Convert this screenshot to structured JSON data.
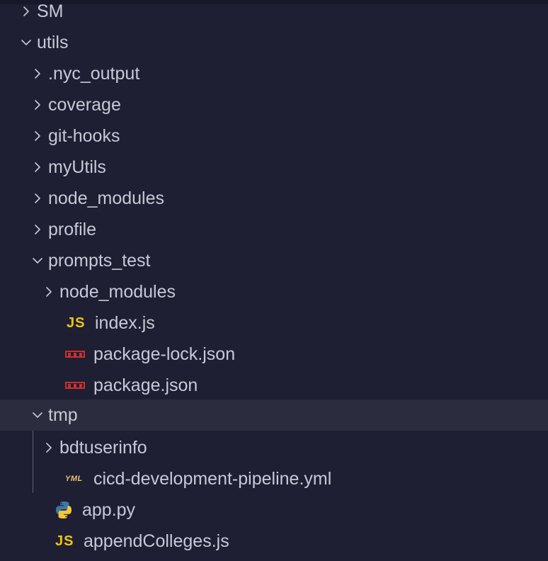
{
  "tree": {
    "items": [
      {
        "label": "SM",
        "kind": "folder",
        "expanded": false,
        "icon": "chevron-right-icon"
      },
      {
        "label": "utils",
        "kind": "folder",
        "expanded": true,
        "icon": "chevron-down-icon"
      },
      {
        "label": ".nyc_output",
        "kind": "folder",
        "expanded": false,
        "icon": "chevron-right-icon"
      },
      {
        "label": "coverage",
        "kind": "folder",
        "expanded": false,
        "icon": "chevron-right-icon"
      },
      {
        "label": "git-hooks",
        "kind": "folder",
        "expanded": false,
        "icon": "chevron-right-icon"
      },
      {
        "label": "myUtils",
        "kind": "folder",
        "expanded": false,
        "icon": "chevron-right-icon"
      },
      {
        "label": "node_modules",
        "kind": "folder",
        "expanded": false,
        "icon": "chevron-right-icon"
      },
      {
        "label": "profile",
        "kind": "folder",
        "expanded": false,
        "icon": "chevron-right-icon"
      },
      {
        "label": "prompts_test",
        "kind": "folder",
        "expanded": true,
        "icon": "chevron-down-icon"
      },
      {
        "label": "node_modules",
        "kind": "folder",
        "expanded": false,
        "icon": "chevron-right-icon"
      },
      {
        "label": "index.js",
        "kind": "file",
        "icon": "javascript-file-icon",
        "icon_text": "JS"
      },
      {
        "label": "package-lock.json",
        "kind": "file",
        "icon": "npm-file-icon"
      },
      {
        "label": "package.json",
        "kind": "file",
        "icon": "npm-file-icon"
      },
      {
        "label": "tmp",
        "kind": "folder",
        "expanded": true,
        "selected": true,
        "icon": "chevron-down-icon"
      },
      {
        "label": "bdtuserinfo",
        "kind": "folder",
        "expanded": false,
        "icon": "chevron-right-icon"
      },
      {
        "label": "cicd-development-pipeline.yml",
        "kind": "file",
        "icon": "yaml-file-icon",
        "icon_text": "YML"
      },
      {
        "label": "app.py",
        "kind": "file",
        "icon": "python-file-icon"
      },
      {
        "label": "appendColleges.js",
        "kind": "file",
        "icon": "javascript-file-icon",
        "icon_text": "JS"
      }
    ]
  },
  "colors": {
    "background": "#1e1f32",
    "selected_row": "#2b2d3f",
    "text": "#c7c9d6",
    "js_icon": "#f1c40f",
    "npm_icon": "#c9302c",
    "yml_icon": "#e6c27a",
    "python_blue": "#3b77a8",
    "python_yellow": "#f0c93a"
  }
}
